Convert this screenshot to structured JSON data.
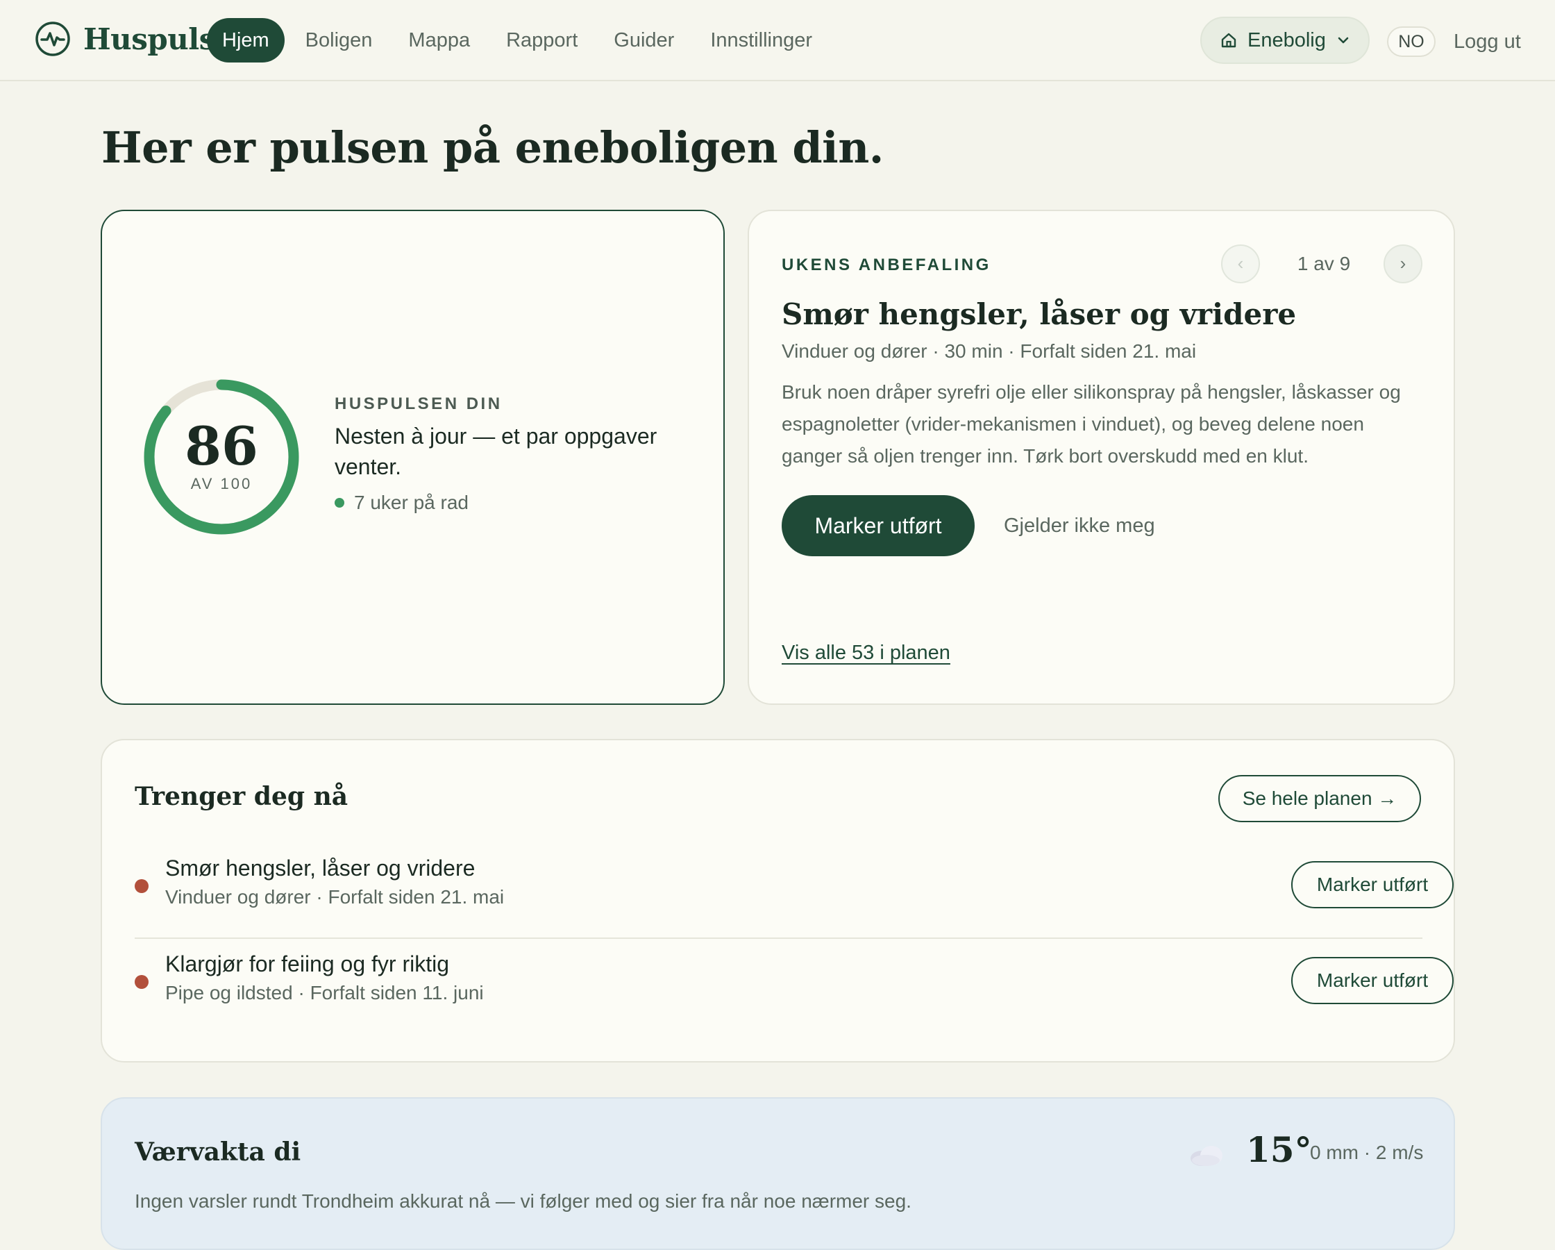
{
  "app": {
    "name": "Huspuls",
    "nav": [
      {
        "label": "Hjem",
        "active": true
      },
      {
        "label": "Boligen",
        "active": false
      },
      {
        "label": "Mappa",
        "active": false
      },
      {
        "label": "Rapport",
        "active": false
      },
      {
        "label": "Guider",
        "active": false
      },
      {
        "label": "Innstillinger",
        "active": false
      }
    ],
    "home_selector": "Enebolig",
    "language": "NO",
    "logout": "Logg ut"
  },
  "headline": "Her er pulsen på eneboligen din.",
  "pulse": {
    "eyebrow": "Huspulsen din",
    "score": "86",
    "score_max_label": "AV 100",
    "score_fraction": 0.86,
    "summary": "Nesten à jour — et par oppgaver venter.",
    "streak": "7 uker på rad"
  },
  "recommendation": {
    "eyebrow": "Ukens anbefaling",
    "pager": "1 av 9",
    "prev_icon": "chevron-left-icon",
    "next_icon": "chevron-right-icon",
    "title": "Smør hengsler, låser og vridere",
    "meta": "Vinduer og dører · 30 min · Forfalt siden 21. mai",
    "body": "Bruk noen dråper syrefri olje eller silikonspray på hengsler, låskasser og espagnoletter (vrider-mekanismen i vinduet), og beveg delene noen ganger så oljen trenger inn. Tørk bort overskudd med en klut.",
    "primary_action": "Marker utført",
    "secondary_action": "Gjelder ikke meg",
    "plan_link": "Vis alle 53 i planen"
  },
  "needs_you": {
    "title": "Trenger deg nå",
    "see_plan": "Se hele planen →",
    "tasks": [
      {
        "title": "Smør hengsler, låser og vridere",
        "meta": "Vinduer og dører · Forfalt siden 21. mai",
        "action": "Marker utført"
      },
      {
        "title": "Klargjør for feiing og fyr riktig",
        "meta": "Pipe og ildsted · Forfalt siden 11. juni",
        "action": "Marker utført"
      }
    ]
  },
  "weather": {
    "title": "Værvakta di",
    "icon": "cloud-icon",
    "temperature": "15°",
    "details": "0 mm · 2 m/s",
    "message": "Ingen varsler rundt Trondheim akkurat nå — vi følger med og sier fra når noe nærmer seg."
  },
  "colors": {
    "brand": "#1f4a37",
    "accent_green": "#3a9960",
    "overdue": "#b2503b",
    "background": "#f4f4ec",
    "weather_bg": "#e4edf4"
  }
}
